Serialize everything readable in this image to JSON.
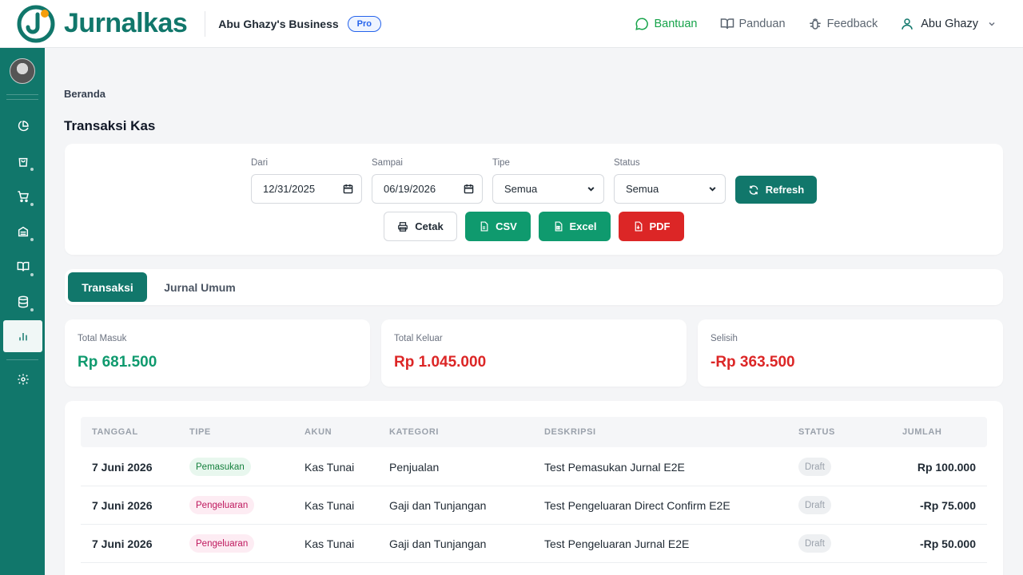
{
  "brand": {
    "name": "Jurnalkas",
    "color": "#11776b",
    "accent": "#f59e0b"
  },
  "business": {
    "name": "Abu Ghazy's Business",
    "plan": "Pro"
  },
  "topnav": {
    "help": "Bantuan",
    "guide": "Panduan",
    "feedback": "Feedback",
    "user": "Abu Ghazy"
  },
  "sidebar": {
    "items": [
      {
        "icon": "pie-chart-icon"
      },
      {
        "icon": "shopping-bag-icon"
      },
      {
        "icon": "cart-icon"
      },
      {
        "icon": "archive-icon"
      },
      {
        "icon": "book-icon"
      },
      {
        "icon": "database-icon"
      },
      {
        "icon": "bar-chart-icon",
        "active": true
      },
      {
        "icon": "gear-icon"
      }
    ]
  },
  "breadcrumb": "Beranda",
  "page_title": "Transaksi Kas",
  "filters": {
    "from_label": "Dari",
    "from_value": "12/31/2025",
    "to_label": "Sampai",
    "to_value": "06/19/2026",
    "type_label": "Tipe",
    "type_value": "Semua",
    "status_label": "Status",
    "status_value": "Semua",
    "refresh": "Refresh",
    "print": "Cetak",
    "csv": "CSV",
    "excel": "Excel",
    "pdf": "PDF"
  },
  "tabs": {
    "active": "Transaksi",
    "other": "Jurnal Umum"
  },
  "stats": {
    "in_label": "Total Masuk",
    "in_value": "Rp 681.500",
    "out_label": "Total Keluar",
    "out_value": "Rp 1.045.000",
    "diff_label": "Selisih",
    "diff_value": "-Rp 363.500",
    "colors": {
      "in": "#0f9a6e",
      "out": "#dc2626"
    }
  },
  "table": {
    "headers": [
      "TANGGAL",
      "TIPE",
      "AKUN",
      "KATEGORI",
      "DESKRIPSI",
      "STATUS",
      "JUMLAH"
    ],
    "rows": [
      {
        "date": "7 Juni 2026",
        "type": "Pemasukan",
        "account": "Kas Tunai",
        "category": "Penjualan",
        "desc": "Test Pemasukan Jurnal E2E",
        "status": "Draft",
        "amount": "Rp 100.000"
      },
      {
        "date": "7 Juni 2026",
        "type": "Pengeluaran",
        "account": "Kas Tunai",
        "category": "Gaji dan Tunjangan",
        "desc": "Test Pengeluaran Direct Confirm E2E",
        "status": "Draft",
        "amount": "-Rp 75.000"
      },
      {
        "date": "7 Juni 2026",
        "type": "Pengeluaran",
        "account": "Kas Tunai",
        "category": "Gaji dan Tunjangan",
        "desc": "Test Pengeluaran Jurnal E2E",
        "status": "Draft",
        "amount": "-Rp 50.000"
      }
    ]
  }
}
